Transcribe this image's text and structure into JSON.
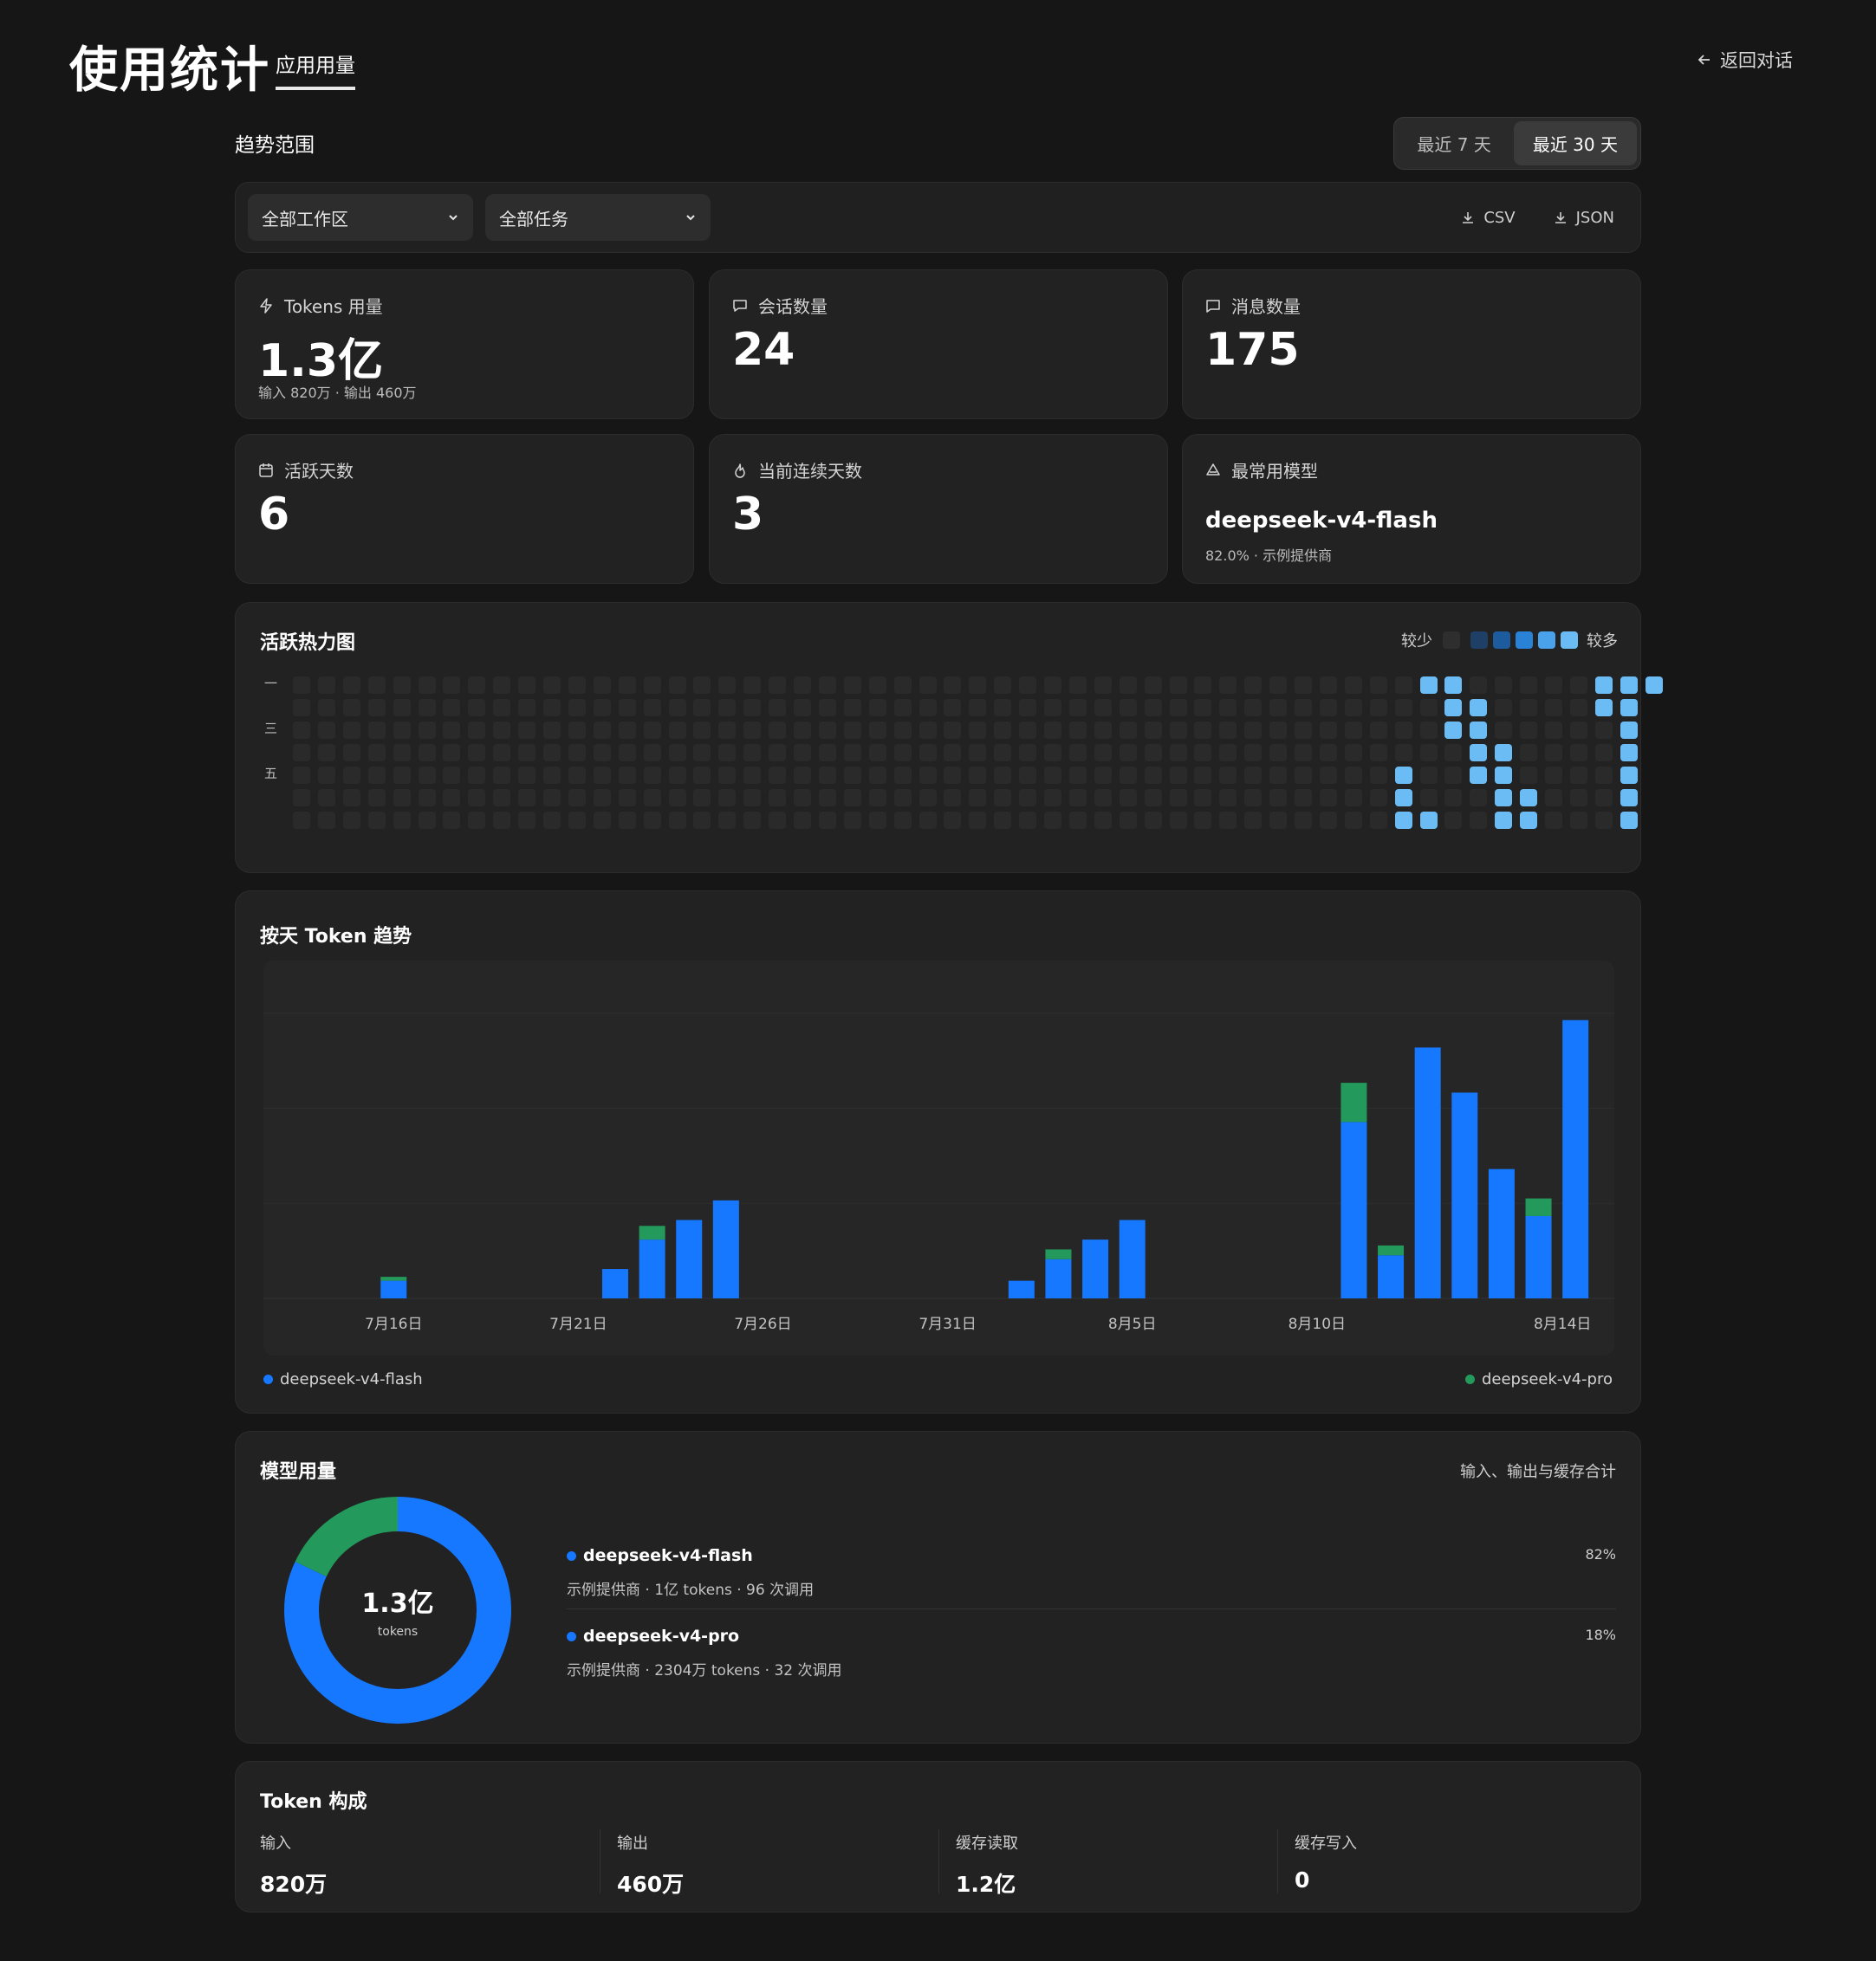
{
  "header": {
    "title": "使用统计",
    "tab": "应用用量",
    "back": "返回对话"
  },
  "range": {
    "label": "趋势范围",
    "options": [
      "最近 7 天",
      "最近 30 天"
    ],
    "selected": "最近 30 天"
  },
  "filters": {
    "workspace": "全部工作区",
    "task": "全部任务",
    "csv": "CSV",
    "json": "JSON"
  },
  "stats": {
    "tokens": {
      "label": "Tokens 用量",
      "value": "1.3亿",
      "sub": "输入 820万 · 输出 460万"
    },
    "sessions": {
      "label": "会话数量",
      "value": "24"
    },
    "messages": {
      "label": "消息数量",
      "value": "175"
    },
    "active_days": {
      "label": "活跃天数",
      "value": "6"
    },
    "streak": {
      "label": "当前连续天数",
      "value": "3"
    },
    "top_model": {
      "label": "最常用模型",
      "name": "deepseek-v4-flash",
      "sub": "82.0% · 示例提供商"
    }
  },
  "heatmap": {
    "title": "活跃热力图",
    "less": "较少",
    "more": "较多",
    "day_labels": [
      "一",
      "三",
      "五"
    ],
    "colors": [
      "#2e2e2e",
      "#1e3f66",
      "#1c5c9e",
      "#2a82d6",
      "#4aa2ea",
      "#6bbcf5"
    ],
    "active_cells": [
      [
        45,
        0,
        5
      ],
      [
        46,
        0,
        5
      ],
      [
        52,
        0,
        5
      ],
      [
        53,
        0,
        5
      ],
      [
        54,
        0,
        5
      ],
      [
        46,
        1,
        5
      ],
      [
        47,
        1,
        5
      ],
      [
        52,
        1,
        5
      ],
      [
        53,
        1,
        5
      ],
      [
        46,
        2,
        5
      ],
      [
        47,
        2,
        5
      ],
      [
        53,
        2,
        5
      ],
      [
        47,
        3,
        5
      ],
      [
        48,
        3,
        5
      ],
      [
        53,
        3,
        5
      ],
      [
        44,
        4,
        5
      ],
      [
        47,
        4,
        5
      ],
      [
        48,
        4,
        5
      ],
      [
        53,
        4,
        5
      ],
      [
        44,
        5,
        5
      ],
      [
        48,
        5,
        5
      ],
      [
        49,
        5,
        5
      ],
      [
        53,
        5,
        5
      ],
      [
        44,
        6,
        5
      ],
      [
        45,
        6,
        5
      ],
      [
        48,
        6,
        5
      ],
      [
        49,
        6,
        5
      ],
      [
        53,
        6,
        5
      ]
    ]
  },
  "chart_data": {
    "type": "bar",
    "title": "按天 Token 趋势",
    "stacked": true,
    "x_ticks": [
      "7月16日",
      "7月21日",
      "7月26日",
      "7月31日",
      "8月5日",
      "8月10日",
      "8月14日"
    ],
    "series": [
      {
        "name": "deepseek-v4-flash",
        "color": "#1677ff",
        "values": [
          0,
          0,
          0.9,
          0,
          0,
          0,
          0,
          0,
          1.5,
          3.0,
          4.0,
          5.0,
          0,
          0,
          0,
          0,
          0,
          0,
          0,
          0.9,
          2.0,
          3.0,
          4.0,
          0,
          0,
          0,
          0,
          0,
          9.0,
          2.2,
          12.8,
          10.5,
          6.6,
          4.2,
          14.2
        ]
      },
      {
        "name": "deepseek-v4-pro",
        "color": "#239a5b",
        "values": [
          0,
          0,
          0.2,
          0,
          0,
          0,
          0,
          0,
          0,
          0.7,
          0,
          0,
          0,
          0,
          0,
          0,
          0,
          0,
          0,
          0,
          0.5,
          0,
          0,
          0,
          0,
          0,
          0,
          0,
          2.0,
          0.5,
          0,
          0,
          0,
          0.9,
          0
        ]
      }
    ]
  },
  "model_usage": {
    "title": "模型用量",
    "note": "输入、输出与缓存合计",
    "total": "1.3亿",
    "total_unit": "tokens",
    "models": [
      {
        "name": "deepseek-v4-flash",
        "desc": "示例提供商 · 1亿 tokens · 96 次调用",
        "pct": "82%",
        "share": 0.82,
        "color": "#1677ff"
      },
      {
        "name": "deepseek-v4-pro",
        "desc": "示例提供商 · 2304万 tokens · 32 次调用",
        "pct": "18%",
        "share": 0.18,
        "color": "#239a5b"
      }
    ]
  },
  "token_composition": {
    "title": "Token 构成",
    "items": [
      {
        "label": "输入",
        "value": "820万"
      },
      {
        "label": "输出",
        "value": "460万"
      },
      {
        "label": "缓存读取",
        "value": "1.2亿"
      },
      {
        "label": "缓存写入",
        "value": "0"
      }
    ]
  }
}
